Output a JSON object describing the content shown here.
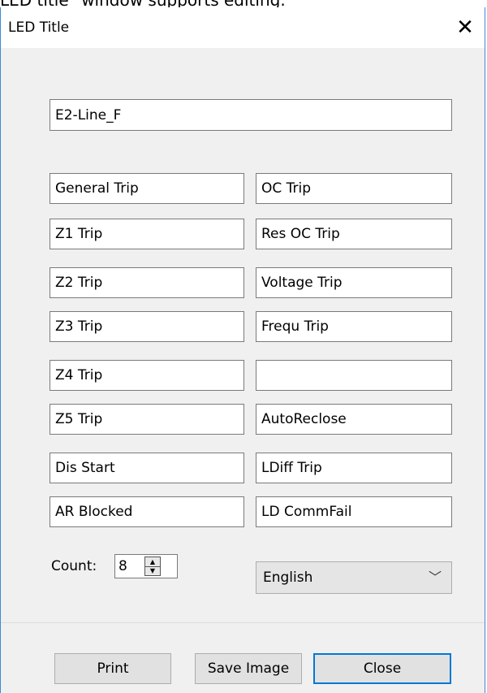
{
  "caption": "LED title\" window supports editing.",
  "window": {
    "title": "LED Title",
    "close_glyph": "✕"
  },
  "name_field": {
    "value": "E2-Line_F"
  },
  "led_labels": {
    "left": [
      "General Trip",
      "Z1 Trip",
      "Z2 Trip",
      "Z3 Trip",
      "Z4 Trip",
      "Z5 Trip",
      "Dis Start",
      "AR Blocked"
    ],
    "right": [
      "OC Trip",
      "Res OC Trip",
      "Voltage Trip",
      "Frequ Trip",
      "",
      "AutoReclose",
      "LDiff Trip",
      "LD CommFail"
    ]
  },
  "count": {
    "label": "Count:",
    "value": "8",
    "up_glyph": "▲",
    "down_glyph": "▼"
  },
  "language": {
    "selected": "English",
    "arrow_glyph": "﹀"
  },
  "buttons": {
    "print": "Print",
    "save_image": "Save Image",
    "close": "Close"
  }
}
